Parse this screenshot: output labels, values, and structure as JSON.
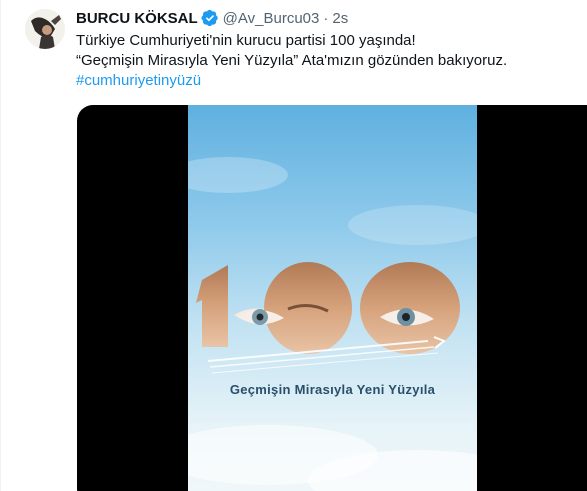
{
  "author": {
    "display_name": "BURCU KÖKSAL",
    "handle": "@Av_Burcu03",
    "separator": "·",
    "time": "2s",
    "verified_icon": "verified-badge-icon",
    "badge_color": "#1d9bf0"
  },
  "tweet": {
    "line1": "Türkiye Cumhuriyeti'nin kurucu partisi 100 yaşında!",
    "line2": "“Geçmişin Mirasıyla Yeni Yüzyıla” Ata'mızın gözünden bakıyoruz.",
    "hashtag": "#cumhuriyetinyüzü"
  },
  "media": {
    "poster_number": "100",
    "poster_subtitle": "Geçmişin Mirasıyla Yeni Yüzyıla"
  }
}
